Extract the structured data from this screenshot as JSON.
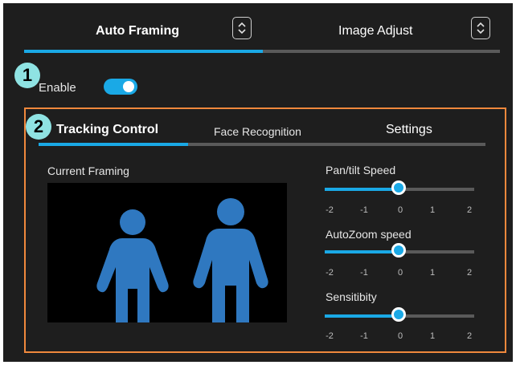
{
  "tabs": [
    {
      "label": "Auto Framing",
      "active": true
    },
    {
      "label": "Image Adjust",
      "active": false
    }
  ],
  "callouts": {
    "one": "1",
    "two": "2"
  },
  "enable": {
    "label": "Enable",
    "on": true
  },
  "sub_tabs": [
    {
      "label": "Tracking Control",
      "active": true
    },
    {
      "label": "Face Recognition",
      "active": false
    },
    {
      "label": "Settings",
      "active": false
    }
  ],
  "framing": {
    "label": "Current Framing"
  },
  "sliders": [
    {
      "label": "Pan/tilt Speed",
      "value": 0,
      "ticks": [
        "-2",
        "-1",
        "0",
        "1",
        "2"
      ]
    },
    {
      "label": "AutoZoom speed",
      "value": 0,
      "ticks": [
        "-2",
        "-1",
        "0",
        "1",
        "2"
      ]
    },
    {
      "label": "Sensitibity",
      "value": 0,
      "ticks": [
        "-2",
        "-1",
        "0",
        "1",
        "2"
      ]
    }
  ],
  "colors": {
    "accent": "#1aa9e6",
    "highlight": "#f0883c",
    "badge": "#8fe3e3",
    "figure": "#2f78c0",
    "background": "#1e1e1e"
  },
  "icons": {
    "tab_selector": "chevron-up-down-icon",
    "person": "person-icon"
  }
}
